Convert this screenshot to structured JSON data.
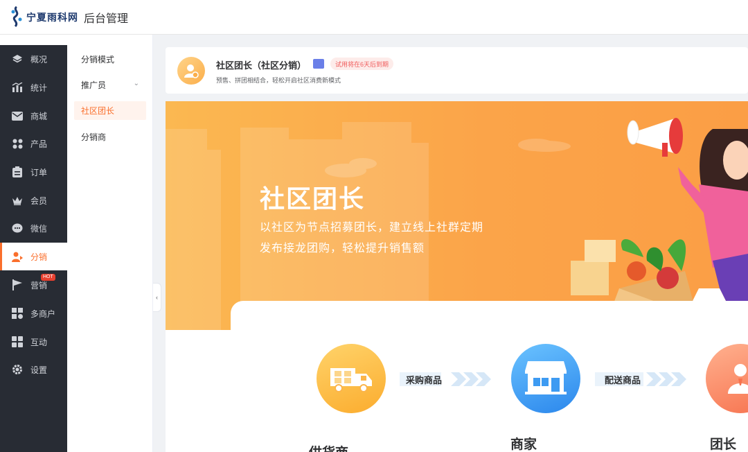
{
  "top": {
    "logo_text": "宁夏雨科网",
    "app_title": "后台管理"
  },
  "menu": [
    {
      "label": "概况",
      "icon": "layers-icon"
    },
    {
      "label": "统计",
      "icon": "bar-chart-icon"
    },
    {
      "label": "商城",
      "icon": "mail-icon"
    },
    {
      "label": "产品",
      "icon": "grid-icon"
    },
    {
      "label": "订单",
      "icon": "clipboard-icon"
    },
    {
      "label": "会员",
      "icon": "crown-icon"
    },
    {
      "label": "微信",
      "icon": "chat-icon"
    },
    {
      "label": "分销",
      "icon": "user-share-icon"
    },
    {
      "label": "营销",
      "icon": "flag-icon",
      "badge": "HOT"
    },
    {
      "label": "多商户",
      "icon": "store-icon"
    },
    {
      "label": "互动",
      "icon": "blocks-icon"
    },
    {
      "label": "设置",
      "icon": "gear-icon"
    }
  ],
  "submenu": [
    {
      "label": "分销模式"
    },
    {
      "label": "推广员"
    },
    {
      "label": "社区团长"
    },
    {
      "label": "分销商"
    }
  ],
  "header": {
    "title": "社区团长（社区分销）",
    "trial": "试用将在6天后到期",
    "desc": "预售、拼团相结合，轻松开启社区消费新模式"
  },
  "banner": {
    "title": "社区团长",
    "line1": "以社区为节点招募团长，建立线上社群定期",
    "line2": "发布接龙团购，轻松提升销售额"
  },
  "flow": {
    "steps": [
      "供货商",
      "商家",
      "团长"
    ],
    "arrows": [
      "采购商品",
      "配送商品"
    ]
  }
}
